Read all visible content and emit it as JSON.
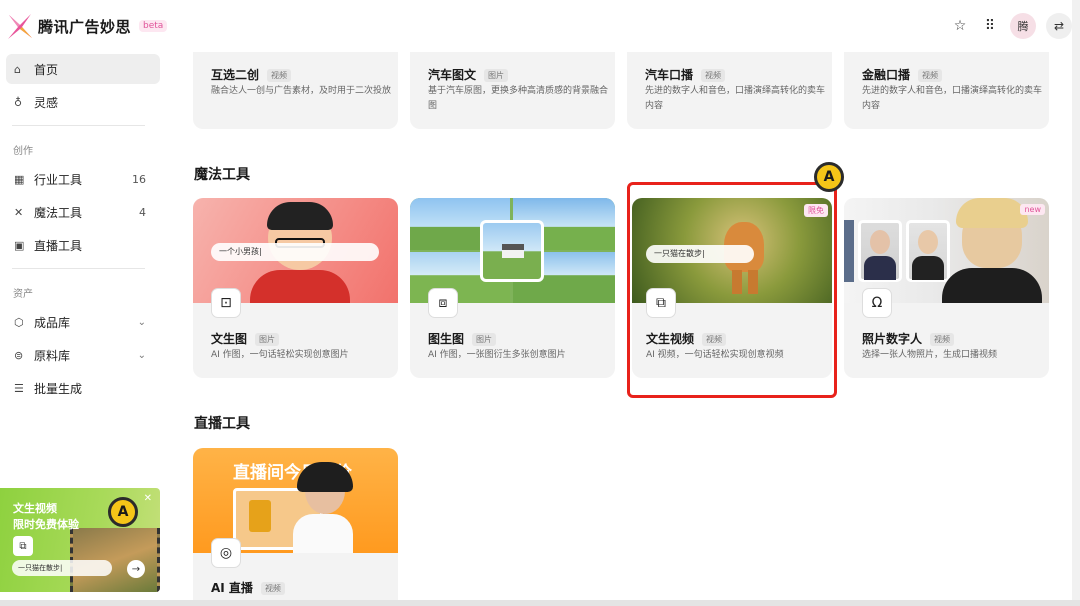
{
  "header": {
    "brand": "腾讯广告妙思",
    "beta": "beta",
    "avatar_text": "腾",
    "icons": [
      "star-icon",
      "grid-icon",
      "swap-icon"
    ]
  },
  "sidebar": {
    "home": "首页",
    "inspiration": "灵感",
    "create_label": "创作",
    "industry_tools": "行业工具",
    "industry_count": "16",
    "magic_tools": "魔法工具",
    "magic_count": "4",
    "live_tools": "直播工具",
    "assets_label": "资产",
    "product_lib": "成品库",
    "material_lib": "原料库",
    "batch": "批量生成"
  },
  "promo": {
    "line1": "文生视频",
    "line2": "限时免费体验",
    "prompt": "一只猫在散步|",
    "badge": "A"
  },
  "top_cards": [
    {
      "title": "互选二创",
      "tag": "视频",
      "desc": "融合达人一创与广告素材，及时用于二次投放"
    },
    {
      "title": "汽车图文",
      "tag": "图片",
      "desc": "基于汽车原图，更换多种高清质感的背景融合图"
    },
    {
      "title": "汽车口播",
      "tag": "视频",
      "desc": "先进的数字人和音色，口播演绎高转化的卖车内容"
    },
    {
      "title": "金融口播",
      "tag": "视频",
      "desc": "先进的数字人和音色，口播演绎高转化的卖车内容"
    }
  ],
  "magic_section": "魔法工具",
  "magic_cards": [
    {
      "title": "文生图",
      "tag": "图片",
      "desc": "AI 作图，一句话轻松实现创意图片",
      "prompt": "一个小男孩|"
    },
    {
      "title": "图生图",
      "tag": "图片",
      "desc": "AI 作图，一张图衍生多张创意图片"
    },
    {
      "title": "文生视频",
      "tag": "视频",
      "desc": "AI 视频，一句话轻松实现创意视频",
      "prompt": "一只猫在散步|",
      "badge": "限免"
    },
    {
      "title": "照片数字人",
      "tag": "视频",
      "desc": "选择一张人物照片，生成口播视频",
      "badge": "new"
    }
  ],
  "live_section": "直播工具",
  "live_cards": [
    {
      "title": "AI 直播",
      "tag": "视频",
      "banner": "直播间今日特价"
    }
  ],
  "marker_badge": "A",
  "colors": {
    "accent_pink": "#e0559a",
    "highlight_red": "#e8221b",
    "badge_yellow": "#f5c518"
  }
}
